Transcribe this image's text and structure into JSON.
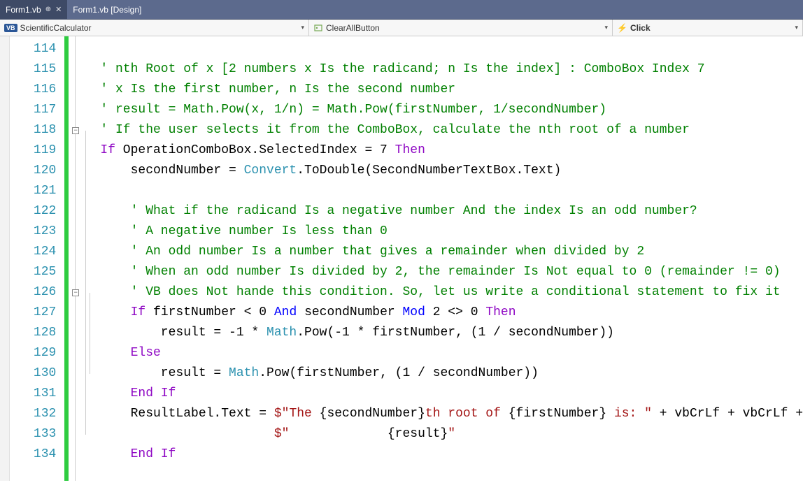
{
  "tabs": {
    "active": "Form1.vb",
    "inactive": "Form1.vb [Design]"
  },
  "nav": {
    "project": "ScientificCalculator",
    "member": "ClearAllButton",
    "event": "Click"
  },
  "lineStart": 114,
  "lineEnd": 134,
  "outline": {
    "minus1_line": 118,
    "minus2_line": 126
  },
  "code": {
    "l114": "' nth Root of x [2 numbers x Is the radicand; n Is the index] : ComboBox Index 7",
    "l115": "' x Is the first number, n Is the second number",
    "l116": "' result = Math.Pow(x, 1/n) = Math.Pow(firstNumber, 1/secondNumber)",
    "l117": "' If the user selects it from the ComboBox, calculate the nth root of a number",
    "l118_if": "If",
    "l118_cond": " OperationComboBox.SelectedIndex = 7 ",
    "l118_then": "Then",
    "l119_a": "    secondNumber = ",
    "l119_conv": "Convert",
    "l119_b": ".ToDouble(SecondNumberTextBox.Text)",
    "l121": "    ' What if the radicand Is a negative number And the index Is an odd number?",
    "l122": "    ' A negative number Is less than 0",
    "l123": "    ' An odd number Is a number that gives a remainder when divided by 2",
    "l124": "    ' When an odd number Is divided by 2, the remainder Is Not equal to 0 (remainder != 0)",
    "l125": "    ' VB does Not hande this condition. So, let us write a conditional statement to fix it",
    "l126_pre": "    ",
    "l126_if": "If",
    "l126_a": " firstNumber < 0 ",
    "l126_and": "And",
    "l126_b": " secondNumber ",
    "l126_mod": "Mod",
    "l126_c": " 2 <> 0 ",
    "l126_then": "Then",
    "l127_a": "        result = -1 * ",
    "l127_math": "Math",
    "l127_b": ".Pow(-1 * firstNumber, (1 / secondNumber))",
    "l128_pre": "    ",
    "l128_else": "Else",
    "l129_a": "        result = ",
    "l129_math": "Math",
    "l129_b": ".Pow(firstNumber, (1 / secondNumber))",
    "l130_pre": "    ",
    "l130_end": "End If",
    "l131_a": "    ResultLabel.Text = ",
    "l131_s1": "$\"The ",
    "l131_i1": "{secondNumber}",
    "l131_s2": "th root of ",
    "l131_i2": "{firstNumber}",
    "l131_s3": " is: \"",
    "l131_b": " + vbCrLf + vbCrLf +",
    "l132_a": "                       ",
    "l132_s1": "$\"             ",
    "l132_i1": "{result}",
    "l132_s2": "\"",
    "l133_pre": "    ",
    "l133_end": "End If"
  }
}
